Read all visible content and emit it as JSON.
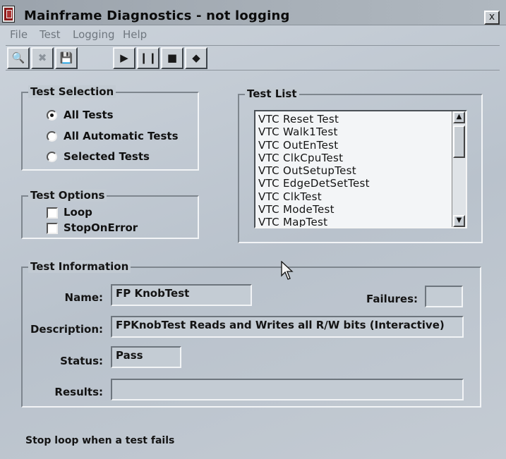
{
  "window": {
    "title": "Mainframe Diagnostics - not logging",
    "close_glyph": "x"
  },
  "menu": {
    "items": [
      "File",
      "Test",
      "Logging",
      "Help"
    ]
  },
  "toolbar": {
    "buttons": [
      {
        "name": "open-icon",
        "glyph": "🔍"
      },
      {
        "name": "clear-icon",
        "glyph": "✖"
      },
      {
        "name": "save-icon",
        "glyph": "💾"
      },
      {
        "name": "play-icon",
        "glyph": "▶"
      },
      {
        "name": "pause-icon",
        "glyph": "❙❙"
      },
      {
        "name": "stop-icon",
        "glyph": "■"
      },
      {
        "name": "step-icon",
        "glyph": "◆"
      }
    ]
  },
  "test_selection": {
    "label": "Test Selection",
    "options": [
      "All Tests",
      "All Automatic Tests",
      "Selected Tests"
    ],
    "selected": "All Tests"
  },
  "test_options": {
    "label": "Test Options",
    "loop": "Loop",
    "stop_on_error": "StopOnError"
  },
  "test_list": {
    "label": "Test List",
    "items": [
      "VTC Reset Test",
      "VTC Walk1Test",
      "VTC OutEnTest",
      "VTC ClkCpuTest",
      "VTC OutSetupTest",
      "VTC EdgeDetSetTest",
      "VTC ClkTest",
      "VTC ModeTest",
      "VTC MapTest"
    ]
  },
  "test_information": {
    "label": "Test Information",
    "name_label": "Name:",
    "name_value": "FP KnobTest",
    "failures_label": "Failures:",
    "failures_value": "",
    "description_label": "Description:",
    "description_value": "FPKnobTest Reads and Writes all R/W bits (Interactive)",
    "status_label": "Status:",
    "status_value": "Pass",
    "results_label": "Results:",
    "results_value": ""
  },
  "status_bar": {
    "text": "Stop loop when a test fails"
  }
}
